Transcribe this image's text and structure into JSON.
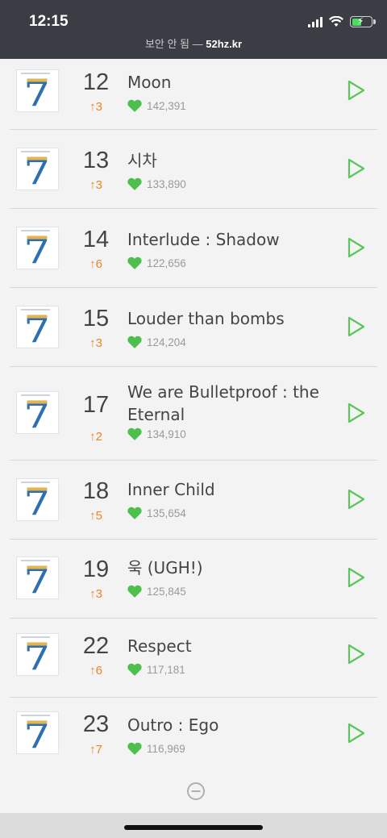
{
  "status_bar": {
    "time": "12:15",
    "url_prefix": "보안 안 됨 — ",
    "url_domain": "52hz.kr"
  },
  "colors": {
    "accent_green": "#4cbf4c",
    "rank_up": "#e8862a",
    "header_bg": "#3a3d44"
  },
  "tracks": [
    {
      "rank": "12",
      "change": "↑3",
      "title": "Moon",
      "likes": "142,391"
    },
    {
      "rank": "13",
      "change": "↑3",
      "title": "시차",
      "likes": "133,890"
    },
    {
      "rank": "14",
      "change": "↑6",
      "title": "Interlude : Shadow",
      "likes": "122,656"
    },
    {
      "rank": "15",
      "change": "↑3",
      "title": "Louder than bombs",
      "likes": "124,204"
    },
    {
      "rank": "17",
      "change": "↑2",
      "title": "We are Bulletproof : the Eternal",
      "likes": "134,910"
    },
    {
      "rank": "18",
      "change": "↑5",
      "title": "Inner Child",
      "likes": "135,654"
    },
    {
      "rank": "19",
      "change": "↑3",
      "title": "욱 (UGH!)",
      "likes": "125,845"
    },
    {
      "rank": "22",
      "change": "↑6",
      "title": "Respect",
      "likes": "117,181"
    },
    {
      "rank": "23",
      "change": "↑7",
      "title": "Outro : Ego",
      "likes": "116,969"
    }
  ],
  "icons": {
    "play": "play-icon",
    "heart": "heart-icon",
    "collapse": "minus-circle-icon"
  }
}
